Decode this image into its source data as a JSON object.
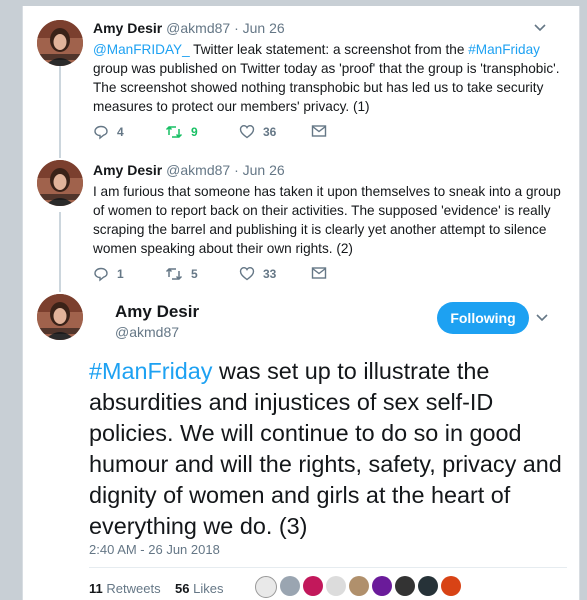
{
  "user": {
    "name": "Amy Desir",
    "handle": "@akmd87"
  },
  "tweets": [
    {
      "dot": "·",
      "date": "Jun 26",
      "mention": "@ManFRIDAY_",
      "text_a": " Twitter leak statement: a screenshot from the ",
      "hashtag": "#ManFriday",
      "text_b": " group was published on Twitter today as 'proof' that the group is 'transphobic'. The screenshot showed nothing transphobic but has led us to take security measures to protect our members' privacy. (1)",
      "replies": "4",
      "retweets": "9",
      "likes": "36"
    },
    {
      "dot": "·",
      "date": "Jun 26",
      "text": "I am furious that someone has taken it upon themselves to sneak into a group of women to report back on their activities. The supposed 'evidence' is really scraping the barrel and publishing it is clearly yet another attempt to silence women speaking about their own rights. (2)",
      "replies": "1",
      "retweets": "5",
      "likes": "33"
    }
  ],
  "main_tweet": {
    "follow_label": "Following",
    "hashtag": "#ManFriday",
    "text": " was set up to illustrate the absurdities and injustices of  sex self-ID policies. We will continue to do so in good humour and will  the rights, safety, privacy and dignity of women and girls at the heart of everything we do. (3)",
    "timestamp": "2:40 AM - 26 Jun 2018",
    "retweet_count": "11",
    "retweet_label": "Retweets",
    "like_count": "56",
    "like_label": "Likes"
  },
  "colors": {
    "accent": "#1da1f2",
    "retweet_active": "#17bf63",
    "muted": "#657786"
  },
  "icons": [
    "reply-icon",
    "retweet-icon",
    "like-icon",
    "message-icon",
    "chevron-down-icon"
  ]
}
